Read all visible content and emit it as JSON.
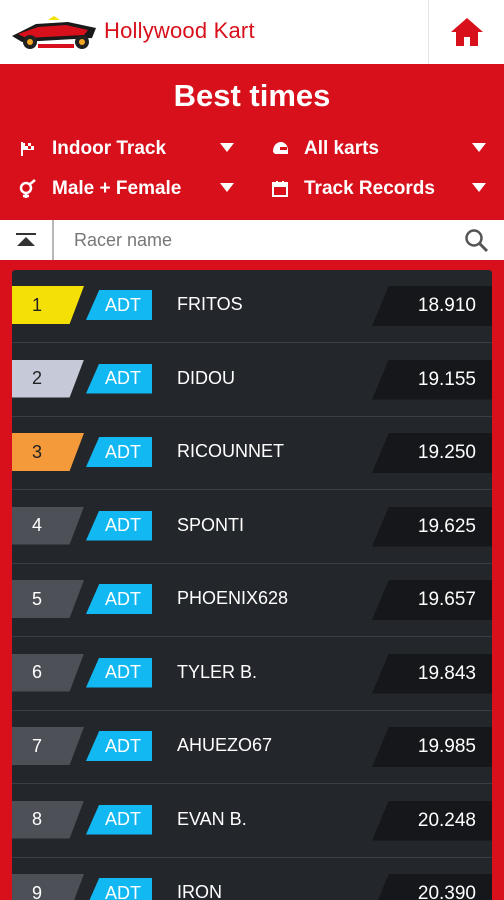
{
  "app": {
    "title": "Hollywood Kart"
  },
  "header": {
    "title": "Best times"
  },
  "filters": {
    "track": "Indoor Track",
    "karts": "All karts",
    "gender": "Male + Female",
    "period": "Track Records"
  },
  "search": {
    "placeholder": "Racer name"
  },
  "colors": {
    "brand": "#d7101b",
    "badge": "#11b8f2",
    "gold": "#f5e006",
    "silver": "#c5c9d8",
    "bronze": "#f49a3a",
    "default_pos": "#4d5057"
  },
  "rows": [
    {
      "pos": "1",
      "badge": "ADT",
      "name": "FRITOS",
      "time": "18.910",
      "pos_color": "#f5e006",
      "pos_text": "#222"
    },
    {
      "pos": "2",
      "badge": "ADT",
      "name": "DIDOU",
      "time": "19.155",
      "pos_color": "#c5c9d8",
      "pos_text": "#222"
    },
    {
      "pos": "3",
      "badge": "ADT",
      "name": "RICOUNNET",
      "time": "19.250",
      "pos_color": "#f49a3a",
      "pos_text": "#222"
    },
    {
      "pos": "4",
      "badge": "ADT",
      "name": "SPONTI",
      "time": "19.625",
      "pos_color": "#4d5057",
      "pos_text": "#fff"
    },
    {
      "pos": "5",
      "badge": "ADT",
      "name": "PHOENIX628",
      "time": "19.657",
      "pos_color": "#4d5057",
      "pos_text": "#fff"
    },
    {
      "pos": "6",
      "badge": "ADT",
      "name": "TYLER B.",
      "time": "19.843",
      "pos_color": "#4d5057",
      "pos_text": "#fff"
    },
    {
      "pos": "7",
      "badge": "ADT",
      "name": "AHUEZO67",
      "time": "19.985",
      "pos_color": "#4d5057",
      "pos_text": "#fff"
    },
    {
      "pos": "8",
      "badge": "ADT",
      "name": "EVAN B.",
      "time": "20.248",
      "pos_color": "#4d5057",
      "pos_text": "#fff"
    },
    {
      "pos": "9",
      "badge": "ADT",
      "name": "IRON",
      "time": "20.390",
      "pos_color": "#4d5057",
      "pos_text": "#fff"
    }
  ]
}
